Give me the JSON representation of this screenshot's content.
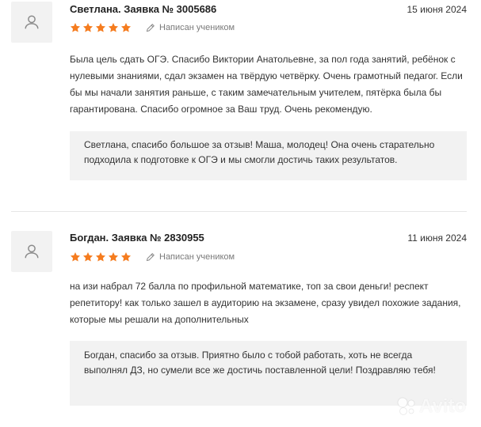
{
  "colors": {
    "star": "#f57c1f",
    "reply_bg": "#f2f2f2",
    "muted": "#7a7a7a"
  },
  "reviews": [
    {
      "title": "Светлана. Заявка № 3005686",
      "date": "15 июня 2024",
      "rating": 5,
      "author_badge": "Написан учеником",
      "text": "Была цель сдать ОГЭ. Спасибо Виктории Анатольевне, за пол года занятий, ребёнок с нулевыми знаниями, сдал экзамен на твёрдую четвёрку. Очень грамотный педагог. Если бы мы начали занятия раньше, с таким замечательным учителем, пятёрка была бы гарантирована. Спасибо огромное за Ваш труд. Очень рекомендую.",
      "reply": "Светлана, спасибо большое за отзыв! Маша, молодец! Она очень старательно подходила к подготовке к ОГЭ и мы смогли достичь таких результатов."
    },
    {
      "title": "Богдан. Заявка № 2830955",
      "date": "11 июня 2024",
      "rating": 5,
      "author_badge": "Написан учеником",
      "text": "на изи набрал 72 балла по профильной математике, топ за свои деньги! респект репетитору! как только зашел в аудиторию на экзамене, сразу увидел похожие задания, которые мы решали на дополнительных",
      "reply": "Богдан, спасибо за отзыв. Приятно было с тобой работать, хоть не всегда выполнял ДЗ, но сумели все же достичь поставленной цели! Поздравляю тебя!"
    }
  ],
  "watermark": "Avito"
}
